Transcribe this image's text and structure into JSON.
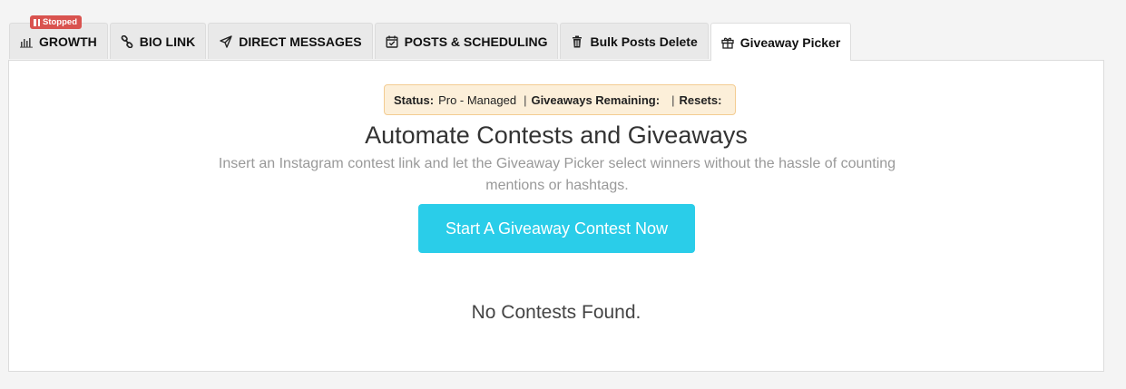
{
  "tabs": [
    {
      "label": "GROWTH",
      "icon": "bar-chart-icon",
      "badge": "Stopped"
    },
    {
      "label": "BIO LINK",
      "icon": "link-icon"
    },
    {
      "label": "DIRECT MESSAGES",
      "icon": "send-icon"
    },
    {
      "label": "POSTS & SCHEDULING",
      "icon": "calendar-check-icon"
    },
    {
      "label": "Bulk Posts Delete",
      "icon": "trash-icon"
    },
    {
      "label": "Giveaway Picker",
      "icon": "gift-icon",
      "active": true
    }
  ],
  "status": {
    "status_label": "Status:",
    "status_value": "Pro - Managed",
    "separator": "|",
    "giveaways_label": "Giveaways Remaining:",
    "giveaways_value": "",
    "resets_label": "Resets:",
    "resets_value": ""
  },
  "main": {
    "headline": "Automate Contests and Giveaways",
    "subtitle": "Insert an Instagram contest link and let the Giveaway Picker select winners without the hassle of counting mentions or hashtags.",
    "cta_label": "Start A Giveaway Contest Now",
    "empty_message": "No Contests Found."
  },
  "colors": {
    "badge": "#d9534f",
    "status_bg": "#fcefd9",
    "status_border": "#f3cc92",
    "cta": "#2acde9"
  }
}
